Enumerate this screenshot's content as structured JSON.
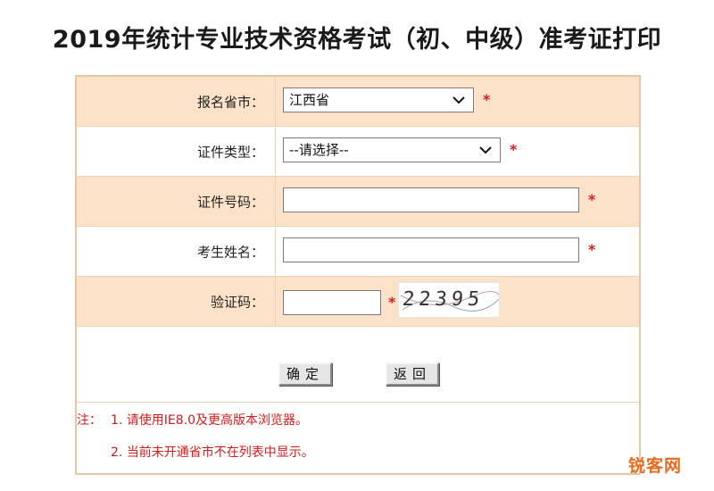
{
  "page": {
    "title": "2019年统计专业技术资格考试（初、中级）准考证打印"
  },
  "form": {
    "province": {
      "label": "报名省市",
      "value": "江西省"
    },
    "id_type": {
      "label": "证件类型",
      "value": "--请选择--"
    },
    "id_number": {
      "label": "证件号码",
      "value": ""
    },
    "name": {
      "label": "考生姓名",
      "value": ""
    },
    "captcha": {
      "label": "验证码",
      "value": "",
      "image_text": "22395"
    },
    "required_mark": "*"
  },
  "buttons": {
    "confirm": "确定",
    "back": "返回"
  },
  "notes": {
    "prefix": "注：",
    "line1": "1. 请使用IE8.0及更高版本浏览器。",
    "line2": "2. 当前未开通省市不在列表中显示。"
  },
  "watermark": "锐客网",
  "colors": {
    "row_shade": "#fbe2c8",
    "border": "#e4c8a6",
    "required": "#d81e1e",
    "note": "#d21b1b",
    "watermark": "#e86a1e"
  }
}
